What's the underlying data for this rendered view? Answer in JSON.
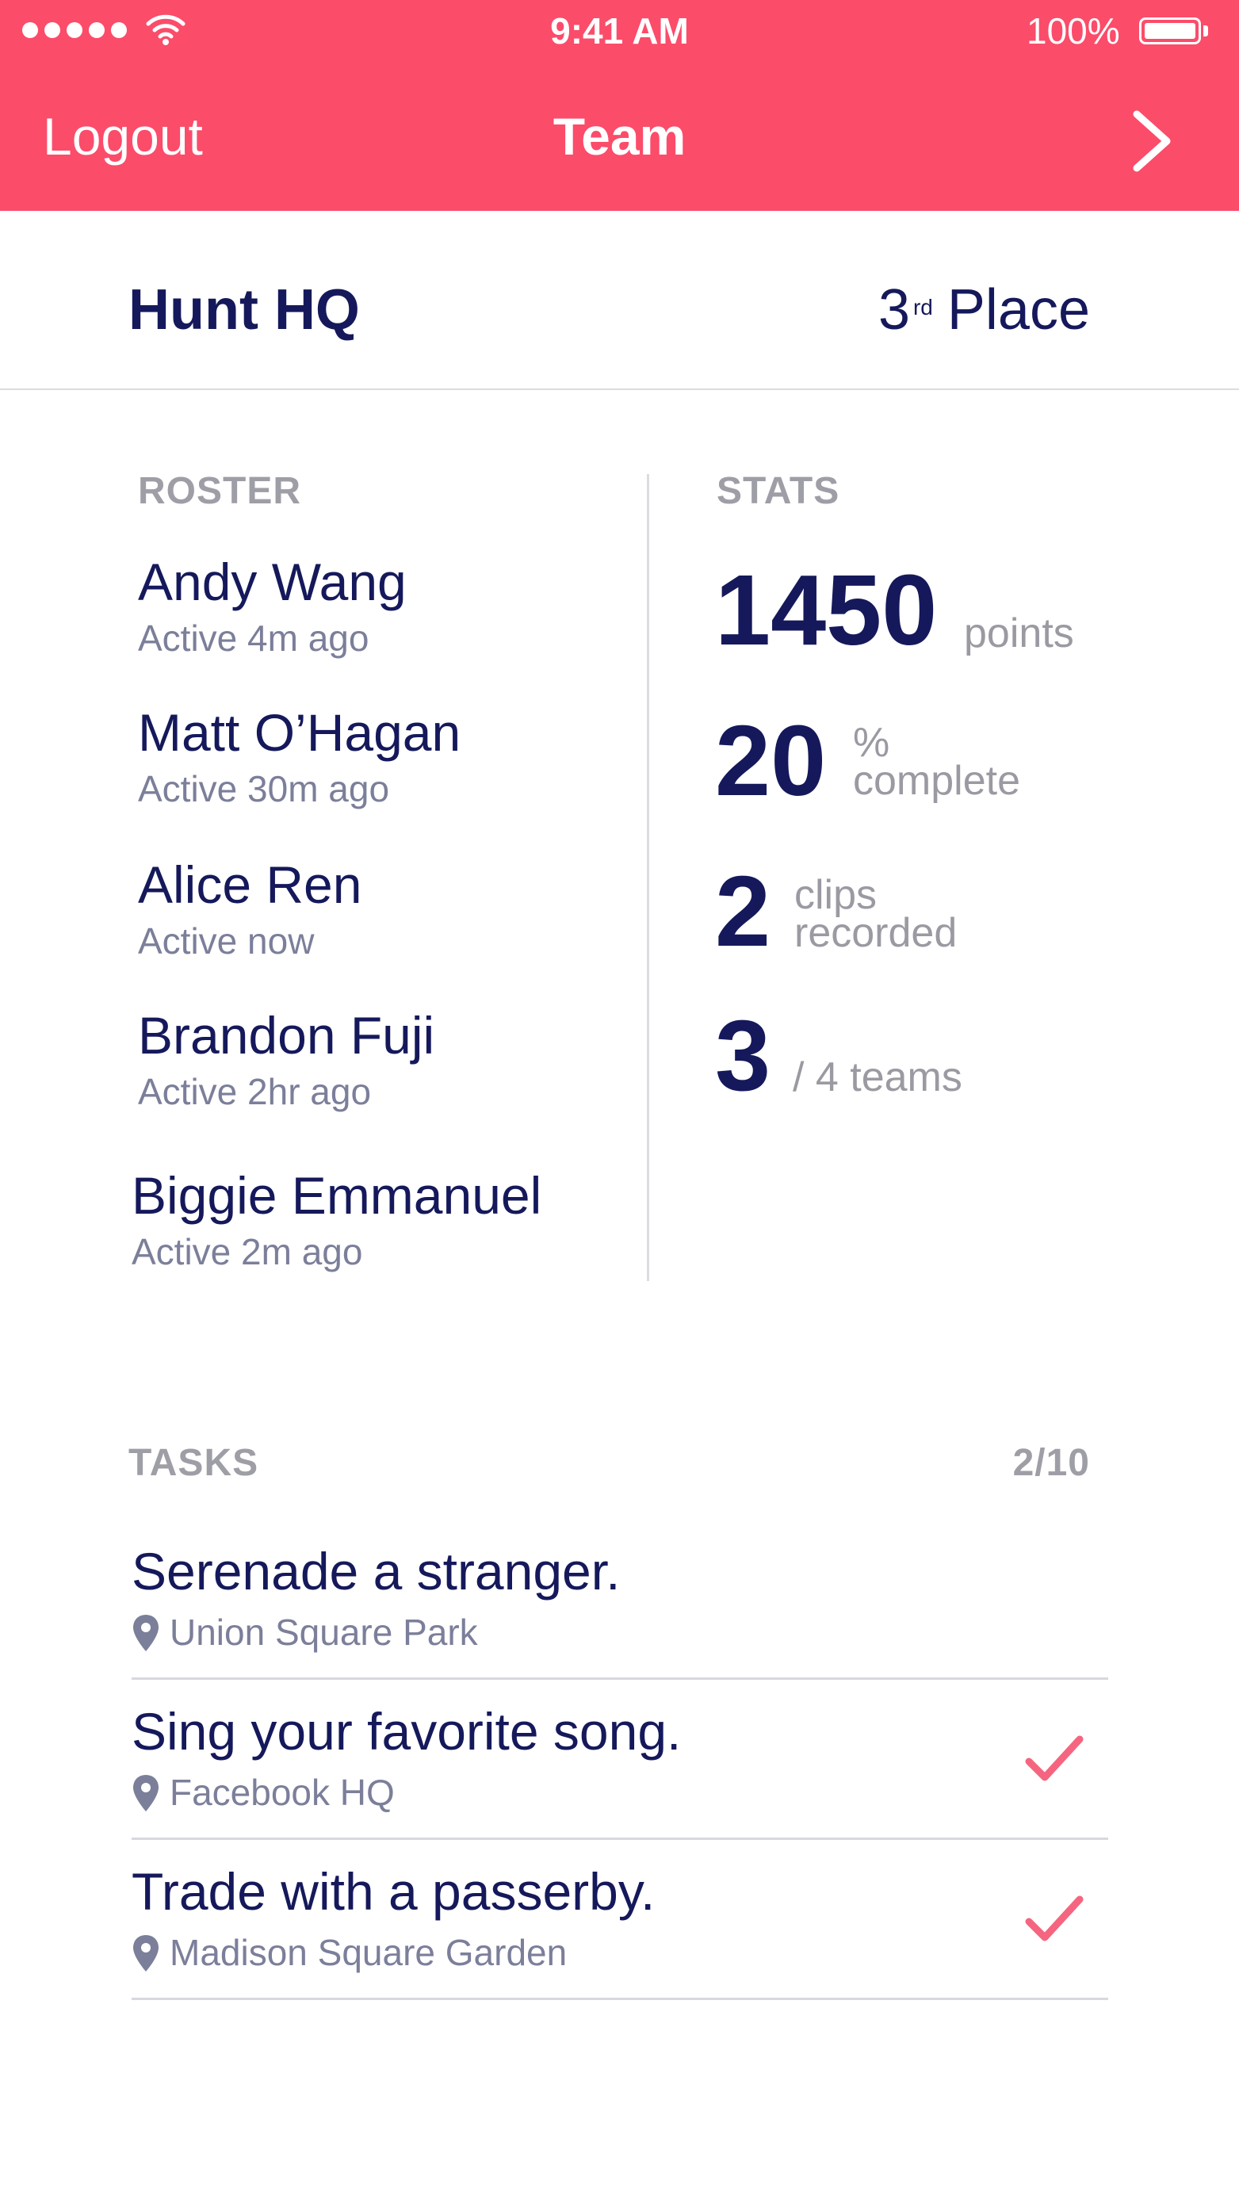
{
  "status_bar": {
    "signal_dots": 5,
    "time": "9:41 AM",
    "battery_label": "100%",
    "battery_level": 1.0
  },
  "nav": {
    "logout_label": "Logout",
    "title": "Team",
    "next_icon": "chevron-right-icon"
  },
  "team": {
    "name": "Hunt HQ",
    "place_number": "3",
    "place_suffix": "rd",
    "place_label": "Place"
  },
  "roster": {
    "label": "ROSTER",
    "members": [
      {
        "name": "Andy Wang",
        "status": "Active 4m ago"
      },
      {
        "name": "Matt O’Hagan",
        "status": "Active 30m ago"
      },
      {
        "name": "Alice Ren",
        "status": "Active now"
      },
      {
        "name": "Brandon Fuji",
        "status": "Active 2hr ago"
      },
      {
        "name": "Biggie Emmanuel",
        "status": "Active 2m ago"
      }
    ]
  },
  "stats": {
    "label": "STATS",
    "points_value": "1450",
    "points_label": "points",
    "complete_value": "20",
    "complete_unit": "%",
    "complete_label": "complete",
    "clips_value": "2",
    "clips_label_1": "clips",
    "clips_label_2": "recorded",
    "rank_value": "3",
    "rank_label": "/ 4 teams"
  },
  "tasks": {
    "label": "TASKS",
    "count": "2/10",
    "items": [
      {
        "title": "Serenade a stranger.",
        "location": "Union Square Park",
        "completed": false
      },
      {
        "title": "Sing your favorite song.",
        "location": "Facebook HQ",
        "completed": true
      },
      {
        "title": "Trade with a passerby.",
        "location": "Madison Square Garden",
        "completed": true
      }
    ]
  },
  "colors": {
    "header": "#fb4c6a",
    "navy": "#15195b",
    "muted": "#9e9ea6",
    "check": "#f5657f"
  },
  "icons": {
    "location": "map-pin-icon",
    "check": "checkmark-icon",
    "wifi": "wifi-icon",
    "battery": "battery-icon"
  }
}
